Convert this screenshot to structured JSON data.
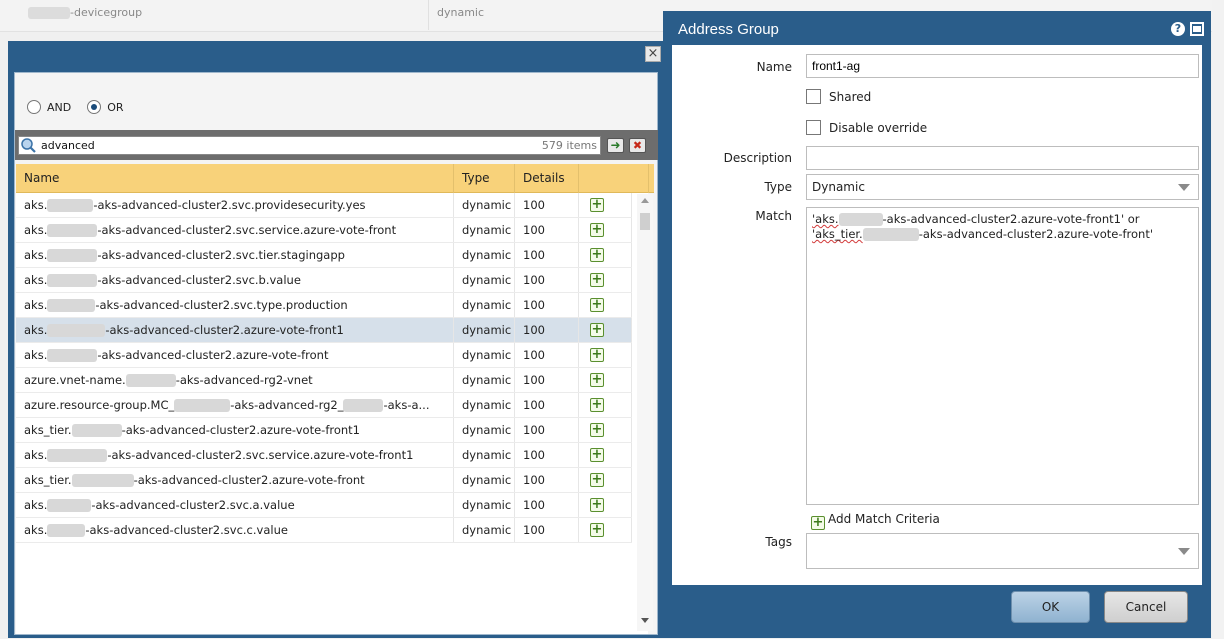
{
  "background": {
    "name_suffix": "-devicegroup",
    "type": "dynamic"
  },
  "filter_dialog": {
    "close_glyph": "×",
    "logic": {
      "and_label": "AND",
      "or_label": "OR",
      "selected": "OR"
    },
    "search": {
      "value": "advanced",
      "count": "579 items"
    },
    "columns": {
      "name": "Name",
      "type": "Type",
      "details": "Details"
    },
    "rows": [
      {
        "prefix": "aks.",
        "suffix": "-aks-advanced-cluster2.svc.providesecurity.yes",
        "type": "dynamic",
        "details": "100"
      },
      {
        "prefix": "aks.",
        "suffix": "-aks-advanced-cluster2.svc.service.azure-vote-front",
        "type": "dynamic",
        "details": "100"
      },
      {
        "prefix": "aks.",
        "suffix": "-aks-advanced-cluster2.svc.tier.stagingapp",
        "type": "dynamic",
        "details": "100"
      },
      {
        "prefix": "aks.",
        "suffix": "-aks-advanced-cluster2.svc.b.value",
        "type": "dynamic",
        "details": "100"
      },
      {
        "prefix": "aks.",
        "suffix": "-aks-advanced-cluster2.svc.type.production",
        "type": "dynamic",
        "details": "100"
      },
      {
        "prefix": "aks.",
        "suffix": "-aks-advanced-cluster2.azure-vote-front1",
        "type": "dynamic",
        "details": "100"
      },
      {
        "prefix": "aks.",
        "suffix": "-aks-advanced-cluster2.azure-vote-front",
        "type": "dynamic",
        "details": "100"
      },
      {
        "prefix": "azure.vnet-name.",
        "suffix": "-aks-advanced-rg2-vnet",
        "type": "dynamic",
        "details": "100"
      },
      {
        "prefix": "azure.resource-group.MC_",
        "suffix": "-aks-advanced-rg2_",
        "suffix2": "-aks-a...",
        "type": "dynamic",
        "details": "100"
      },
      {
        "prefix": "aks_tier.",
        "suffix": "-aks-advanced-cluster2.azure-vote-front1",
        "type": "dynamic",
        "details": "100"
      },
      {
        "prefix": "aks.",
        "suffix": "-aks-advanced-cluster2.svc.service.azure-vote-front1",
        "type": "dynamic",
        "details": "100"
      },
      {
        "prefix": "aks_tier.",
        "suffix": "-aks-advanced-cluster2.azure-vote-front",
        "type": "dynamic",
        "details": "100"
      },
      {
        "prefix": "aks.",
        "suffix": "-aks-advanced-cluster2.svc.a.value",
        "type": "dynamic",
        "details": "100"
      },
      {
        "prefix": "aks.",
        "suffix": "-aks-advanced-cluster2.svc.c.value",
        "type": "dynamic",
        "details": "100"
      }
    ],
    "selected_row_index": 5
  },
  "address_group": {
    "title": "Address Group",
    "help_glyph": "?",
    "name_label": "Name",
    "name_value": "front1-ag",
    "shared_label": "Shared",
    "disable_override_label": "Disable override",
    "description_label": "Description",
    "description_value": "",
    "type_label": "Type",
    "type_value": "Dynamic",
    "match_label": "Match",
    "match": {
      "part1_prefix": "'aks.",
      "part1_suffix": "-aks-advanced-cluster2.azure-vote-front1'",
      "operator": " or",
      "part2_prefix": "'aks_tier.",
      "part2_suffix": "-aks-advanced-cluster2.azure-vote-front'"
    },
    "add_match_label": "Add Match Criteria",
    "tags_label": "Tags",
    "ok_label": "OK",
    "cancel_label": "Cancel"
  }
}
